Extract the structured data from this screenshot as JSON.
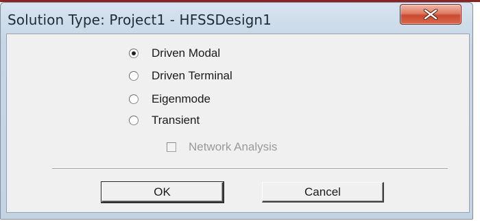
{
  "dialog": {
    "title": "Solution Type: Project1 - HFSSDesign1",
    "close_icon": "close-x-icon",
    "options": [
      {
        "label": "Driven Modal",
        "checked": true
      },
      {
        "label": "Driven Terminal",
        "checked": false
      },
      {
        "label": "Eigenmode",
        "checked": false
      },
      {
        "label": "Transient",
        "checked": false
      }
    ],
    "network_analysis": {
      "label": "Network Analysis",
      "checked": false,
      "enabled": false
    },
    "buttons": {
      "ok": "OK",
      "cancel": "Cancel"
    }
  },
  "colors": {
    "title_gradient_top": "#d7e3ef",
    "title_gradient_bottom": "#c3d3e4",
    "close_button_red": "#c94a30",
    "client_background": "#f0f0f0",
    "disabled_text": "#9a9a9a"
  }
}
